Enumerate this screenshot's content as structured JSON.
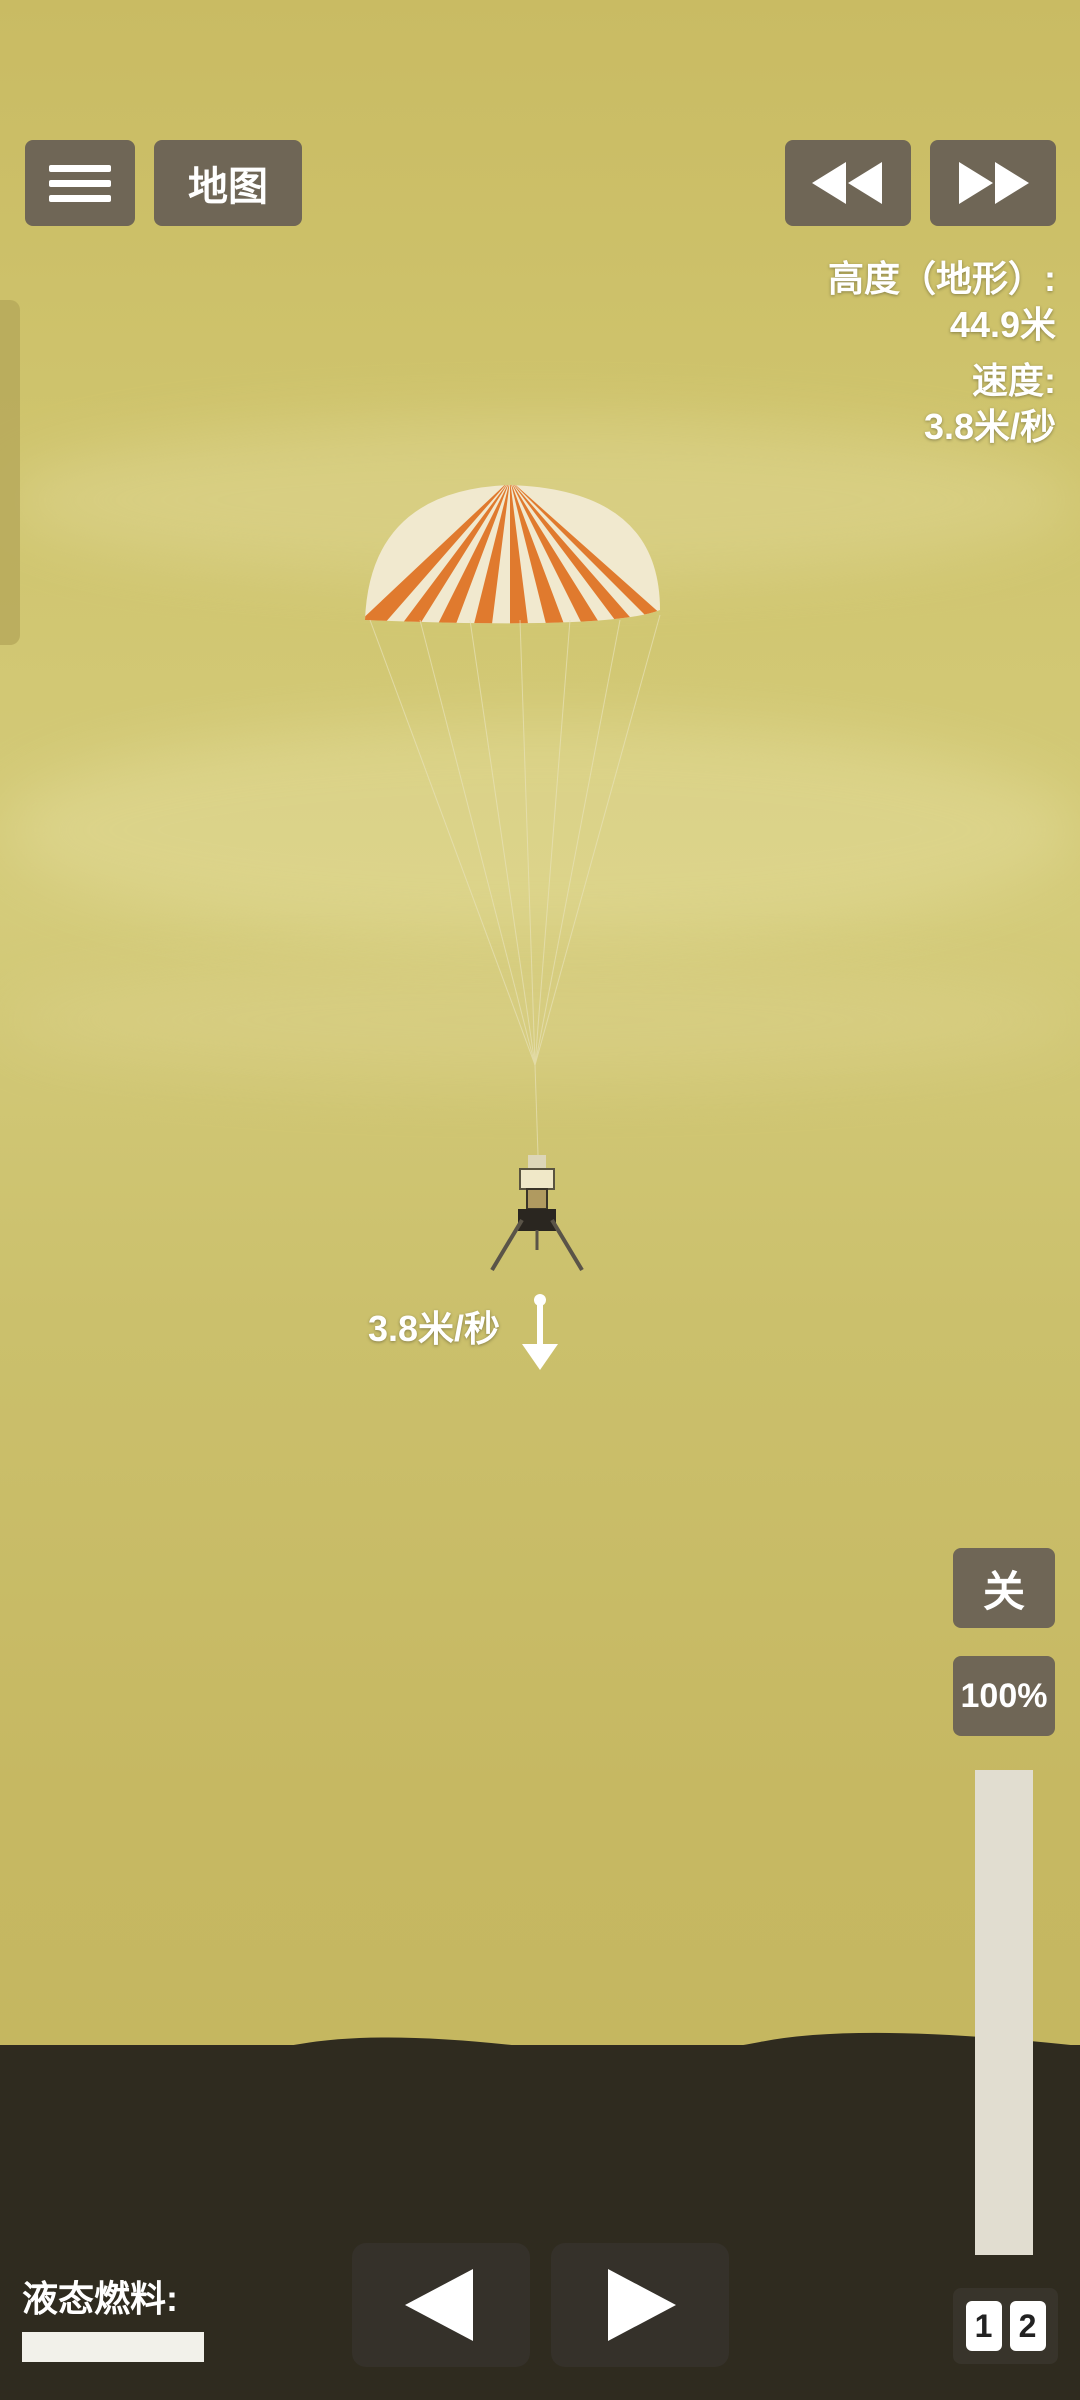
{
  "header": {
    "map_label": "地图"
  },
  "telemetry": {
    "altitude_label": "高度（地形）:",
    "altitude_value": "44.9米",
    "speed_label": "速度:",
    "speed_value": "3.8米/秒"
  },
  "vehicle": {
    "velocity_label": "3.8米/秒"
  },
  "controls": {
    "toggle_label": "关",
    "throttle_label": "100%",
    "throttle_level": 1.0
  },
  "fuel": {
    "label": "液态燃料:",
    "level": 1.0
  },
  "stages": [
    "1",
    "2"
  ],
  "icons": {
    "menu": "hamburger-icon",
    "rewind": "rewind-icon",
    "fast_forward": "fast-forward-icon",
    "rotate_left": "triangle-left-icon",
    "rotate_right": "triangle-right-icon",
    "velocity": "down-arrow-icon"
  },
  "colors": {
    "button_bg": "#6f6656",
    "ground": "#2f2b1f",
    "sky": "#cfc46d",
    "parachute_orange": "#e07a2e",
    "parachute_white": "#f1e9cf"
  }
}
